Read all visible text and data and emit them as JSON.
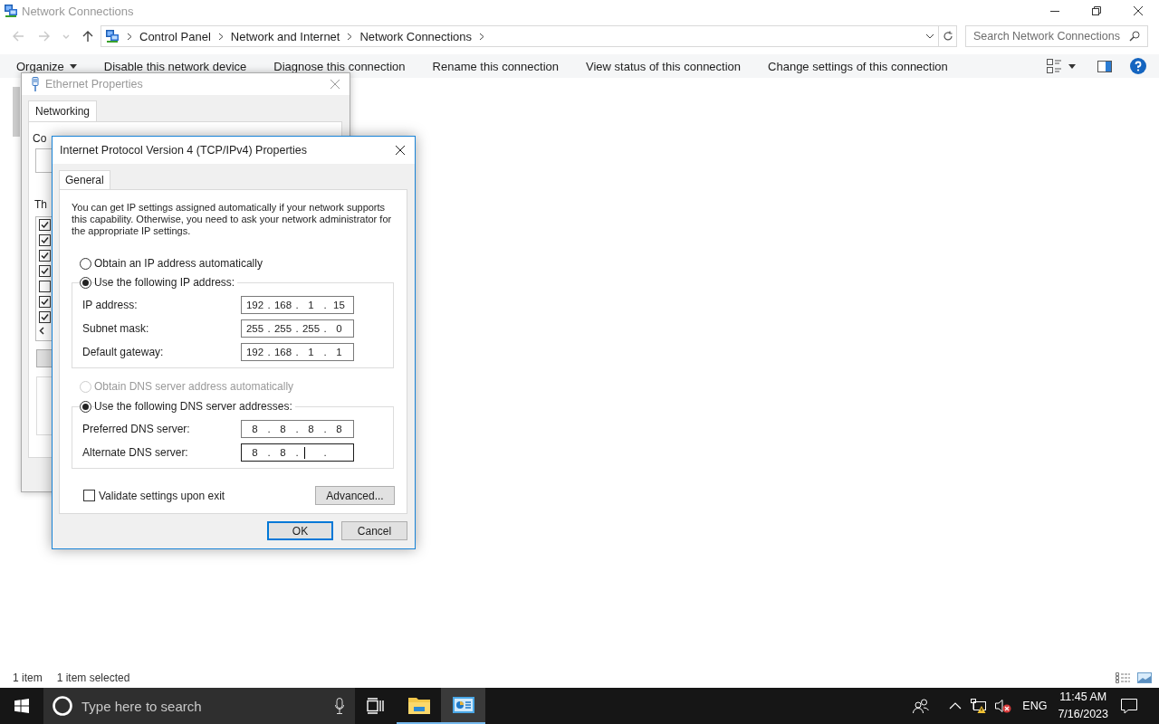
{
  "window": {
    "title": "Network Connections"
  },
  "address_bar": {
    "breadcrumbs": [
      "Control Panel",
      "Network and Internet",
      "Network Connections"
    ]
  },
  "search": {
    "placeholder": "Search Network Connections"
  },
  "toolbar": {
    "items": [
      {
        "label": "Organize",
        "kind": "menu"
      },
      {
        "label": "Disable this network device",
        "kind": "command"
      },
      {
        "label": "Diagnose this connection",
        "kind": "command"
      },
      {
        "label": "Rename this connection",
        "kind": "command"
      },
      {
        "label": "View status of this connection",
        "kind": "command"
      },
      {
        "label": "Change settings of this connection",
        "kind": "command"
      }
    ]
  },
  "status_bar": {
    "items": [
      "1 item",
      "1 item selected"
    ]
  },
  "ethernet": {
    "title": "Ethernet Properties",
    "tabs": [
      {
        "label": "Networking",
        "selected": true
      }
    ],
    "fragments": [
      "Co",
      "Th"
    ],
    "components": [
      {
        "checked": true
      },
      {
        "checked": true
      },
      {
        "checked": true
      },
      {
        "checked": true
      },
      {
        "checked": false
      },
      {
        "checked": true
      },
      {
        "checked": true
      }
    ]
  },
  "ipv4": {
    "title": "Internet Protocol Version 4 (TCP/IPv4) Properties",
    "tabs": [
      {
        "label": "General",
        "selected": true
      }
    ],
    "description": "You can get IP settings assigned automatically if your network supports this capability. Otherwise, you need to ask your network administrator for the appropriate IP settings.",
    "ip_options": [
      {
        "label": "Obtain an IP address automatically",
        "selected": false,
        "disabled": false
      },
      {
        "label": "Use the following IP address:",
        "selected": true,
        "disabled": false
      }
    ],
    "ip_fields": [
      {
        "label": "IP address:",
        "parts": [
          "192",
          ".",
          "168",
          ".",
          "1",
          ".",
          "15"
        ],
        "focused": false
      },
      {
        "label": "Subnet mask:",
        "parts": [
          "255",
          ".",
          "255",
          ".",
          "255",
          ".",
          "0"
        ],
        "focused": false
      },
      {
        "label": "Default gateway:",
        "parts": [
          "192",
          ".",
          "168",
          ".",
          "1",
          ".",
          "1"
        ],
        "focused": false
      }
    ],
    "dns_options": [
      {
        "label": "Obtain DNS server address automatically",
        "selected": false,
        "disabled": true
      },
      {
        "label": "Use the following DNS server addresses:",
        "selected": true,
        "disabled": false
      }
    ],
    "dns_fields": [
      {
        "label": "Preferred DNS server:",
        "parts": [
          "8",
          ".",
          "8",
          ".",
          "8",
          ".",
          "8"
        ],
        "focused": false
      },
      {
        "label": "Alternate DNS server:",
        "parts": [
          "8",
          ".",
          "8",
          "."
        ],
        "focused": true,
        "after_caret": [
          "."
        ]
      }
    ],
    "validate": {
      "label": "Validate settings upon exit",
      "checked": false
    },
    "buttons": [
      {
        "label": "Advanced...",
        "kind": "advanced"
      },
      {
        "label": "OK",
        "kind": "default"
      },
      {
        "label": "Cancel",
        "kind": "normal"
      }
    ]
  },
  "taskbar": {
    "search_placeholder": "Type here to search",
    "apps": [
      {
        "kind": "folder",
        "selected": false,
        "running": true
      },
      {
        "kind": "control-panel",
        "selected": true,
        "running": true
      }
    ],
    "tray": {
      "language": "ENG",
      "time": "11:45 AM",
      "date": "7/16/2023"
    }
  }
}
